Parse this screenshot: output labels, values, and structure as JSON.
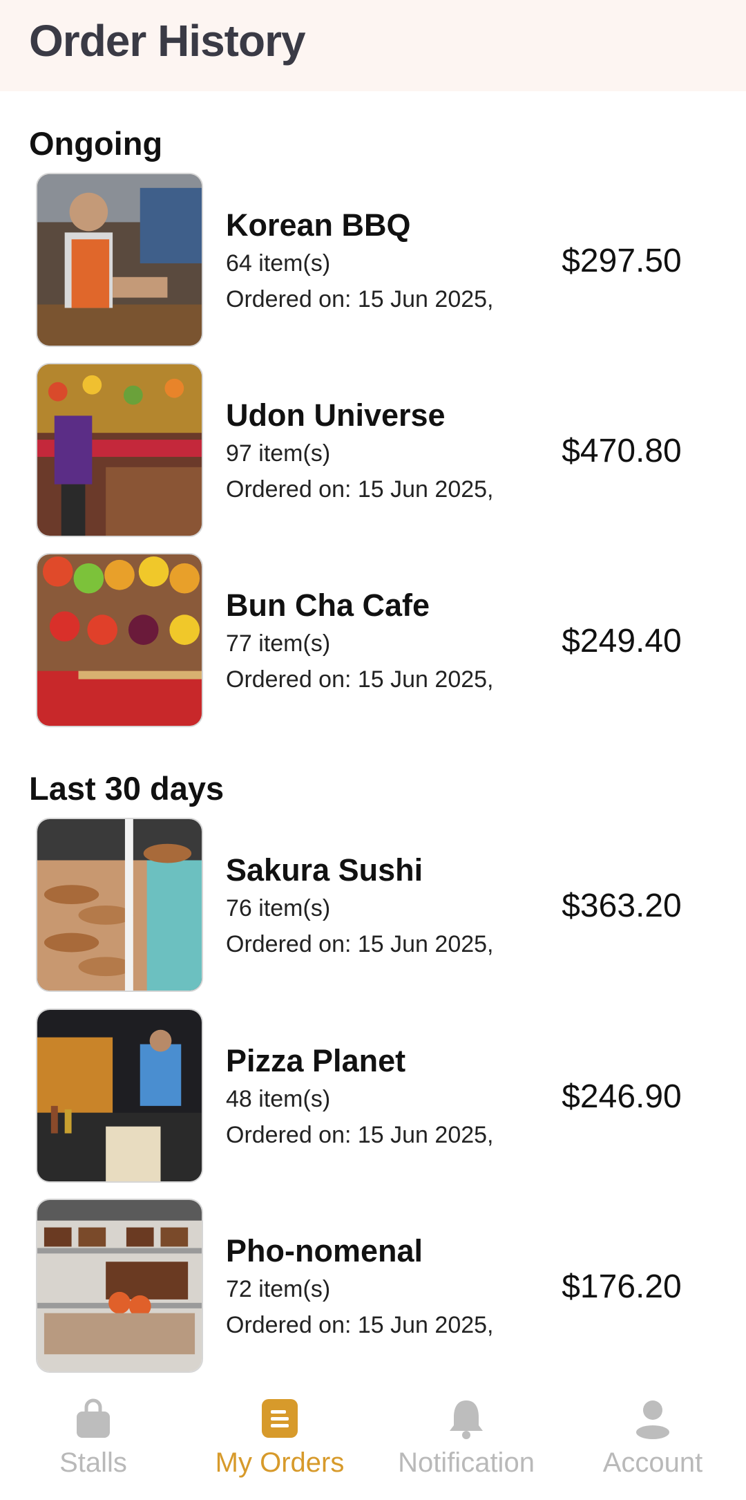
{
  "header": {
    "title": "Order History"
  },
  "sections": [
    {
      "title": "Ongoing",
      "orders": [
        {
          "name": "Korean BBQ",
          "items": "64 item(s)",
          "date": "Ordered on: 15 Jun 2025,",
          "price": "$297.50"
        },
        {
          "name": "Udon Universe",
          "items": "97 item(s)",
          "date": "Ordered on: 15 Jun 2025,",
          "price": "$470.80"
        },
        {
          "name": "Bun Cha Cafe",
          "items": "77 item(s)",
          "date": "Ordered on: 15 Jun 2025,",
          "price": "$249.40"
        }
      ]
    },
    {
      "title": "Last 30 days",
      "orders": [
        {
          "name": "Sakura Sushi",
          "items": "76 item(s)",
          "date": "Ordered on: 15 Jun 2025,",
          "price": "$363.20"
        },
        {
          "name": "Pizza Planet",
          "items": "48 item(s)",
          "date": "Ordered on: 15 Jun 2025,",
          "price": "$246.90"
        },
        {
          "name": "Pho-nomenal",
          "items": "72 item(s)",
          "date": "Ordered on: 15 Jun 2025,",
          "price": "$176.20"
        }
      ]
    }
  ],
  "tabbar": {
    "items": [
      {
        "label": "Stalls",
        "icon": "shopping-bag-icon"
      },
      {
        "label": "My Orders",
        "icon": "orders-list-icon"
      },
      {
        "label": "Notification",
        "icon": "bell-icon"
      },
      {
        "label": "Account",
        "icon": "user-icon"
      }
    ],
    "active_color": "#d79a2b",
    "inactive_color": "#b9b9b9"
  }
}
